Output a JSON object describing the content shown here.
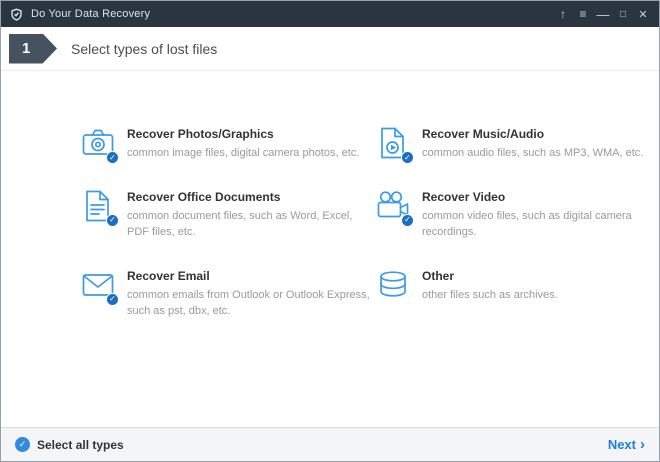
{
  "titlebar": {
    "app_title": "Do Your Data Recovery"
  },
  "step": {
    "number": "1",
    "title": "Select types of lost files"
  },
  "file_types": [
    {
      "name": "Recover Photos/Graphics",
      "description": "common image files, digital camera photos, etc.",
      "icon": "camera-icon",
      "checked": true
    },
    {
      "name": "Recover Music/Audio",
      "description": "common audio files, such as MP3, WMA, etc.",
      "icon": "music-file-icon",
      "checked": true
    },
    {
      "name": "Recover Office Documents",
      "description": "common document files, such as Word, Excel, PDF files, etc.",
      "icon": "document-icon",
      "checked": true
    },
    {
      "name": "Recover Video",
      "description": "common video files, such as digital camera recordings.",
      "icon": "video-camera-icon",
      "checked": true
    },
    {
      "name": "Recover Email",
      "description": "common emails from Outlook or Outlook Express, such as pst, dbx, etc.",
      "icon": "envelope-icon",
      "checked": true
    },
    {
      "name": "Other",
      "description": "other files such as archives.",
      "icon": "disk-stack-icon",
      "checked": false
    }
  ],
  "footer": {
    "select_all_label": "Select all types",
    "next_label": "Next"
  },
  "glyphs": {
    "check": "✓",
    "next_chevron": "›",
    "upgrade_arrow": "↑",
    "menu": "≡",
    "minimize": "—",
    "maximize": "□",
    "close": "✕"
  },
  "colors": {
    "accent_blue": "#3d9ae8",
    "check_blue": "#1b6ec2",
    "titlebar_bg": "#2b3542",
    "link_blue": "#1e7fe0"
  }
}
